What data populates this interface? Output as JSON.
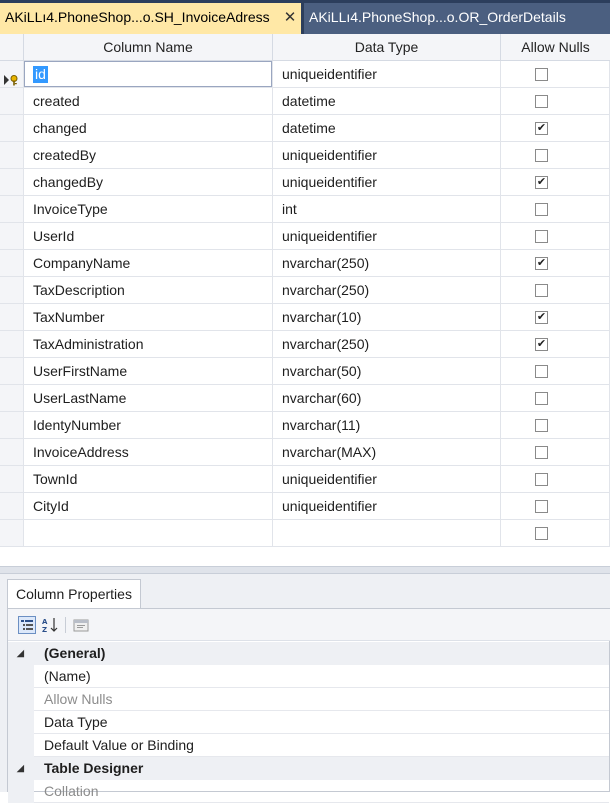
{
  "tabs": [
    {
      "label": "AKiLLı4.PhoneShop...o.SH_InvoiceAdress",
      "active": true,
      "close_glyph": "✕"
    },
    {
      "label": "AKiLLı4.PhoneShop...o.OR_OrderDetails",
      "active": false
    }
  ],
  "grid": {
    "headers": {
      "column_name": "Column Name",
      "data_type": "Data Type",
      "allow_nulls": "Allow Nulls"
    },
    "selected_row_indicator": "primary-key-icon",
    "rows": [
      {
        "name": "id",
        "type": "uniqueidentifier",
        "allow_nulls": false,
        "primary_key": true,
        "editing": true
      },
      {
        "name": "created",
        "type": "datetime",
        "allow_nulls": false
      },
      {
        "name": "changed",
        "type": "datetime",
        "allow_nulls": true
      },
      {
        "name": "createdBy",
        "type": "uniqueidentifier",
        "allow_nulls": false
      },
      {
        "name": "changedBy",
        "type": "uniqueidentifier",
        "allow_nulls": true
      },
      {
        "name": "InvoiceType",
        "type": "int",
        "allow_nulls": false
      },
      {
        "name": "UserId",
        "type": "uniqueidentifier",
        "allow_nulls": false
      },
      {
        "name": "CompanyName",
        "type": "nvarchar(250)",
        "allow_nulls": true
      },
      {
        "name": "TaxDescription",
        "type": "nvarchar(250)",
        "allow_nulls": false
      },
      {
        "name": "TaxNumber",
        "type": "nvarchar(10)",
        "allow_nulls": true
      },
      {
        "name": "TaxAdministration",
        "type": "nvarchar(250)",
        "allow_nulls": true
      },
      {
        "name": "UserFirstName",
        "type": "nvarchar(50)",
        "allow_nulls": false
      },
      {
        "name": "UserLastName",
        "type": "nvarchar(60)",
        "allow_nulls": false
      },
      {
        "name": "IdentyNumber",
        "type": "nvarchar(11)",
        "allow_nulls": false
      },
      {
        "name": "InvoiceAddress",
        "type": "nvarchar(MAX)",
        "allow_nulls": false
      },
      {
        "name": "TownId",
        "type": "uniqueidentifier",
        "allow_nulls": false
      },
      {
        "name": "CityId",
        "type": "uniqueidentifier",
        "allow_nulls": false
      },
      {
        "name": "",
        "type": "",
        "allow_nulls": false
      }
    ]
  },
  "properties": {
    "tab_label": "Column Properties",
    "toolbar": [
      "categorized-icon",
      "alphabetical-sort-icon",
      "property-pages-icon"
    ],
    "rows": [
      {
        "kind": "category",
        "label": "(General)",
        "expanded": true
      },
      {
        "kind": "property",
        "label": "(Name)"
      },
      {
        "kind": "property",
        "label": "Allow Nulls",
        "disabled": true
      },
      {
        "kind": "property",
        "label": "Data Type"
      },
      {
        "kind": "property",
        "label": "Default Value or Binding"
      },
      {
        "kind": "category",
        "label": "Table Designer",
        "expanded": true
      },
      {
        "kind": "property",
        "label": "Collation",
        "disabled": true
      }
    ]
  },
  "colors": {
    "active_tab": "#ffe8a6",
    "tabstrip": "#2c3e5c",
    "selection": "#3399ff"
  }
}
